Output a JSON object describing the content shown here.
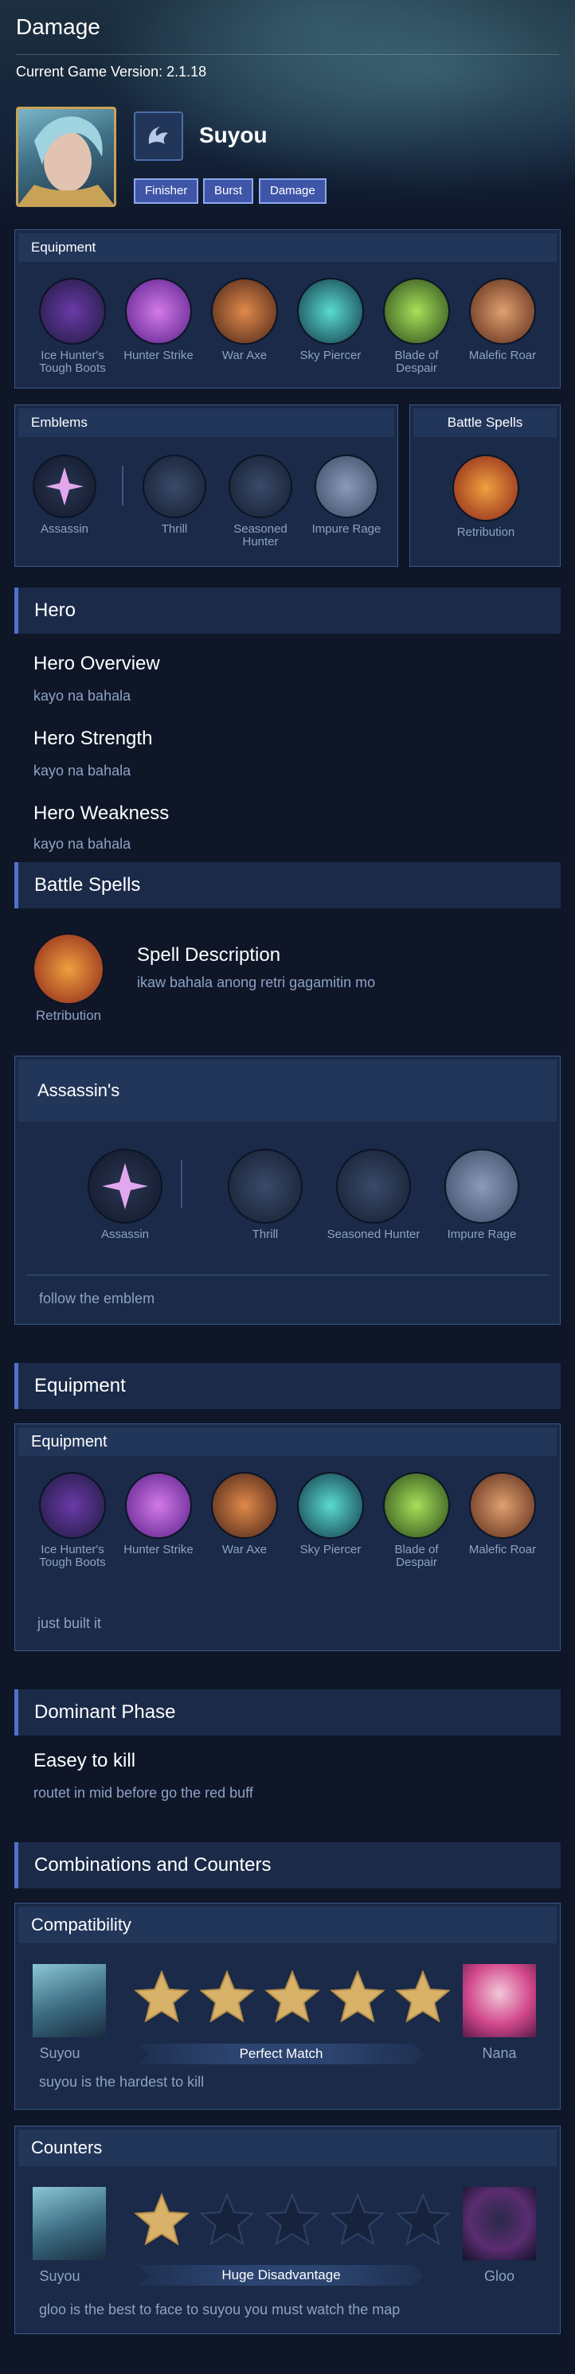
{
  "header": {
    "title": "Damage",
    "version": "Current Game Version: 2.1.18",
    "hero_name": "Suyou",
    "tags": [
      "Finisher",
      "Burst",
      "Damage"
    ]
  },
  "equipment_top": {
    "title": "Equipment",
    "items": [
      "Ice Hunter's Tough Boots",
      "Hunter Strike",
      "War Axe",
      "Sky Piercer",
      "Blade of Despair",
      "Malefic Roar"
    ]
  },
  "emblems_top": {
    "title": "Emblems",
    "main": "Assassin",
    "talents": [
      "Thrill",
      "Seasoned Hunter",
      "Impure Rage"
    ]
  },
  "battle_spells_top": {
    "title": "Battle Spells",
    "spell": "Retribution"
  },
  "hero_section": {
    "title": "Hero",
    "overview_title": "Hero Overview",
    "overview_text": "kayo na bahala",
    "strength_title": "Hero Strength",
    "strength_text": "kayo na bahala",
    "weakness_title": "Hero Weakness",
    "weakness_text": "kayo na bahala"
  },
  "battle_spells_section": {
    "title": "Battle Spells",
    "spell": "Retribution",
    "desc_title": "Spell Description",
    "desc_text": "ikaw bahala anong retri gagamitin mo"
  },
  "emblem_detail": {
    "title": "Assassin's",
    "main": "Assassin",
    "talents": [
      "Thrill",
      "Seasoned Hunter",
      "Impure Rage"
    ],
    "note": "follow the emblem"
  },
  "equipment_section": {
    "title": "Equipment",
    "panel_title": "Equipment",
    "items": [
      "Ice Hunter's Tough Boots",
      "Hunter Strike",
      "War Axe",
      "Sky Piercer",
      "Blade of Despair",
      "Malefic Roar"
    ],
    "note": "just built it"
  },
  "dominant_phase": {
    "title": "Dominant Phase",
    "heading": "Easey to kill",
    "text": "routet in mid before go the red buff"
  },
  "combos": {
    "title": "Combinations and Counters",
    "compat": {
      "title": "Compatibility",
      "left": "Suyou",
      "right": "Nana",
      "rating": 5,
      "max": 5,
      "verdict": "Perfect Match",
      "note": "suyou is the hardest to kill"
    },
    "counters": {
      "title": "Counters",
      "left": "Suyou",
      "right": "Gloo",
      "rating": 1,
      "max": 5,
      "verdict": "Huge Disadvantage",
      "note": "gloo is the best to face to suyou you must watch the map"
    }
  },
  "colors": {
    "background": "#0e1628",
    "panel": "#1a2a48",
    "accent": "#4f72c8",
    "star": "#d9b26a"
  }
}
